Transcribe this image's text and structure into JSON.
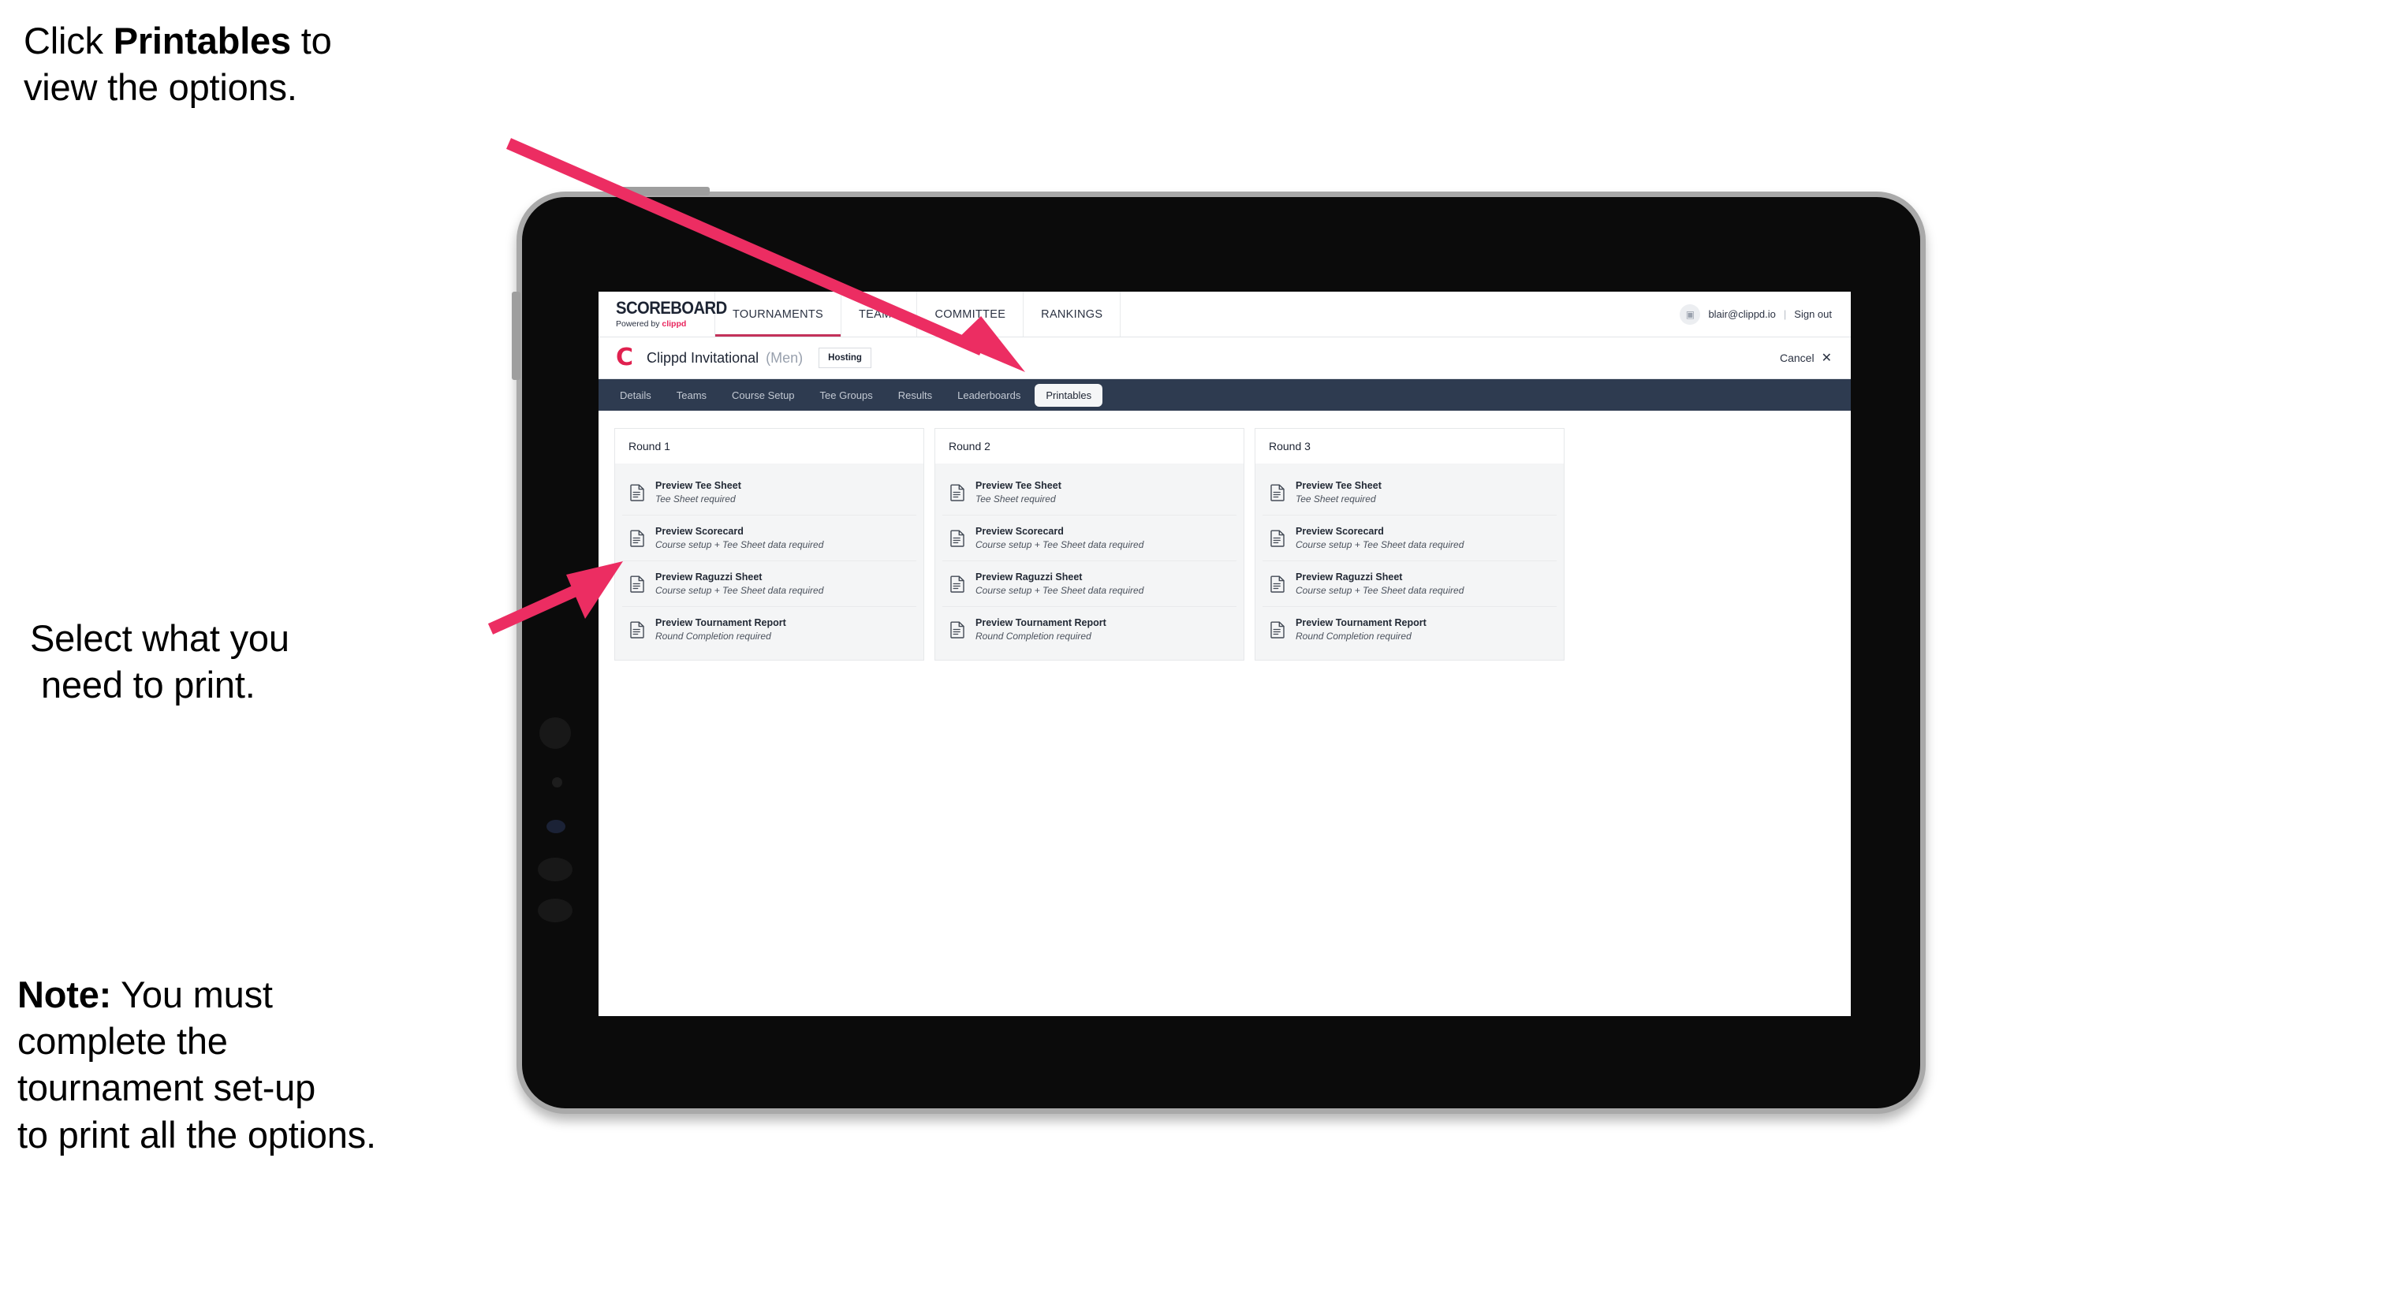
{
  "annotations": {
    "top": {
      "pre": "Click ",
      "bold": "Printables",
      "post": " to",
      "line2": "view the options."
    },
    "middle": {
      "line1": "Select what you",
      "line2": "need to print."
    },
    "note": {
      "bold": "Note:",
      "rest": " You must",
      "line2": "complete the",
      "line3": "tournament set-up",
      "line4": "to print all the options."
    }
  },
  "app": {
    "brand": {
      "title": "SCOREBOARD",
      "sub_prefix": "Powered by ",
      "sub_brand": "clippd"
    },
    "nav": [
      {
        "label": "TOURNAMENTS",
        "active": true
      },
      {
        "label": "TEAMS",
        "active": false
      },
      {
        "label": "COMMITTEE",
        "active": false
      },
      {
        "label": "RANKINGS",
        "active": false
      }
    ],
    "user": {
      "avatar_glyph": "▣",
      "email": "blair@clippd.io",
      "separator": "|",
      "sign_out": "Sign out"
    },
    "tournament": {
      "logo_letter": "C",
      "name": "Clippd Invitational",
      "gender": "(Men)",
      "status_badge": "Hosting",
      "cancel_label": "Cancel",
      "cancel_icon": "✕"
    },
    "tabs": [
      {
        "label": "Details",
        "active": false
      },
      {
        "label": "Teams",
        "active": false
      },
      {
        "label": "Course Setup",
        "active": false
      },
      {
        "label": "Tee Groups",
        "active": false
      },
      {
        "label": "Results",
        "active": false
      },
      {
        "label": "Leaderboards",
        "active": false
      },
      {
        "label": "Printables",
        "active": true
      }
    ],
    "rounds": [
      {
        "title": "Round 1",
        "items": [
          {
            "title": "Preview Tee Sheet",
            "subtitle": "Tee Sheet required",
            "icon": "document-icon"
          },
          {
            "title": "Preview Scorecard",
            "subtitle": "Course setup + Tee Sheet data required",
            "icon": "document-icon"
          },
          {
            "title": "Preview Raguzzi Sheet",
            "subtitle": "Course setup + Tee Sheet data required",
            "icon": "document-icon"
          },
          {
            "title": "Preview Tournament Report",
            "subtitle": "Round Completion required",
            "icon": "document-icon"
          }
        ]
      },
      {
        "title": "Round 2",
        "items": [
          {
            "title": "Preview Tee Sheet",
            "subtitle": "Tee Sheet required",
            "icon": "document-icon"
          },
          {
            "title": "Preview Scorecard",
            "subtitle": "Course setup + Tee Sheet data required",
            "icon": "document-icon"
          },
          {
            "title": "Preview Raguzzi Sheet",
            "subtitle": "Course setup + Tee Sheet data required",
            "icon": "document-icon"
          },
          {
            "title": "Preview Tournament Report",
            "subtitle": "Round Completion required",
            "icon": "document-icon"
          }
        ]
      },
      {
        "title": "Round 3",
        "items": [
          {
            "title": "Preview Tee Sheet",
            "subtitle": "Tee Sheet required",
            "icon": "document-icon"
          },
          {
            "title": "Preview Scorecard",
            "subtitle": "Course setup + Tee Sheet data required",
            "icon": "document-icon"
          },
          {
            "title": "Preview Raguzzi Sheet",
            "subtitle": "Course setup + Tee Sheet data required",
            "icon": "document-icon"
          },
          {
            "title": "Preview Tournament Report",
            "subtitle": "Round Completion required",
            "icon": "document-icon"
          }
        ]
      }
    ]
  },
  "colors": {
    "accent_pink": "#ec2d62",
    "brand_red": "#e0214f",
    "tabbar_navy": "#2e3b50",
    "nav_underline": "#c3315a",
    "card_body": "#f4f5f6"
  }
}
